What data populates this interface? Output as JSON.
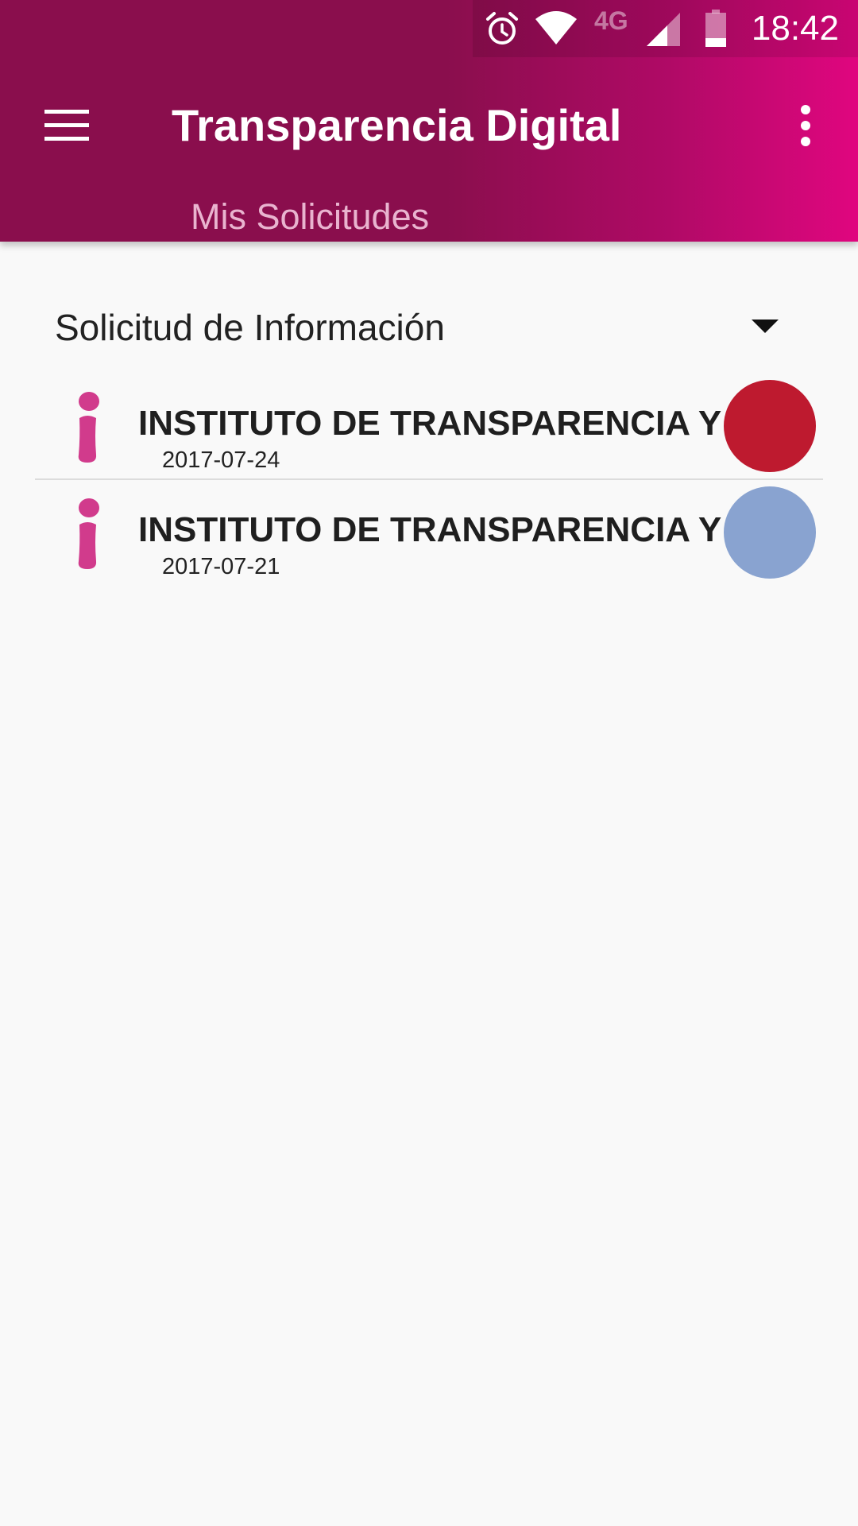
{
  "status_bar": {
    "time": "18:42",
    "network": "4G",
    "icons": [
      "alarm-icon",
      "wifi-icon",
      "signal-icon",
      "battery-icon"
    ]
  },
  "toolbar": {
    "title": "Transparencia Digital",
    "subtitle": "Mis Solicitudes",
    "menu_icon": "hamburger-menu-icon",
    "overflow_icon": "more-vert-icon"
  },
  "filter": {
    "selected": "Solicitud de Información"
  },
  "requests": [
    {
      "institution": "INSTITUTO DE TRANSPARENCIA Y A",
      "date": "2017-07-24",
      "status_color": "#be1a2f"
    },
    {
      "institution": "INSTITUTO DE TRANSPARENCIA Y A",
      "date": "2017-07-21",
      "status_color": "#89a3d0"
    }
  ],
  "colors": {
    "primary": "#8a0e4d",
    "accent": "#e0067f",
    "icon_pink": "#d13b8c"
  }
}
